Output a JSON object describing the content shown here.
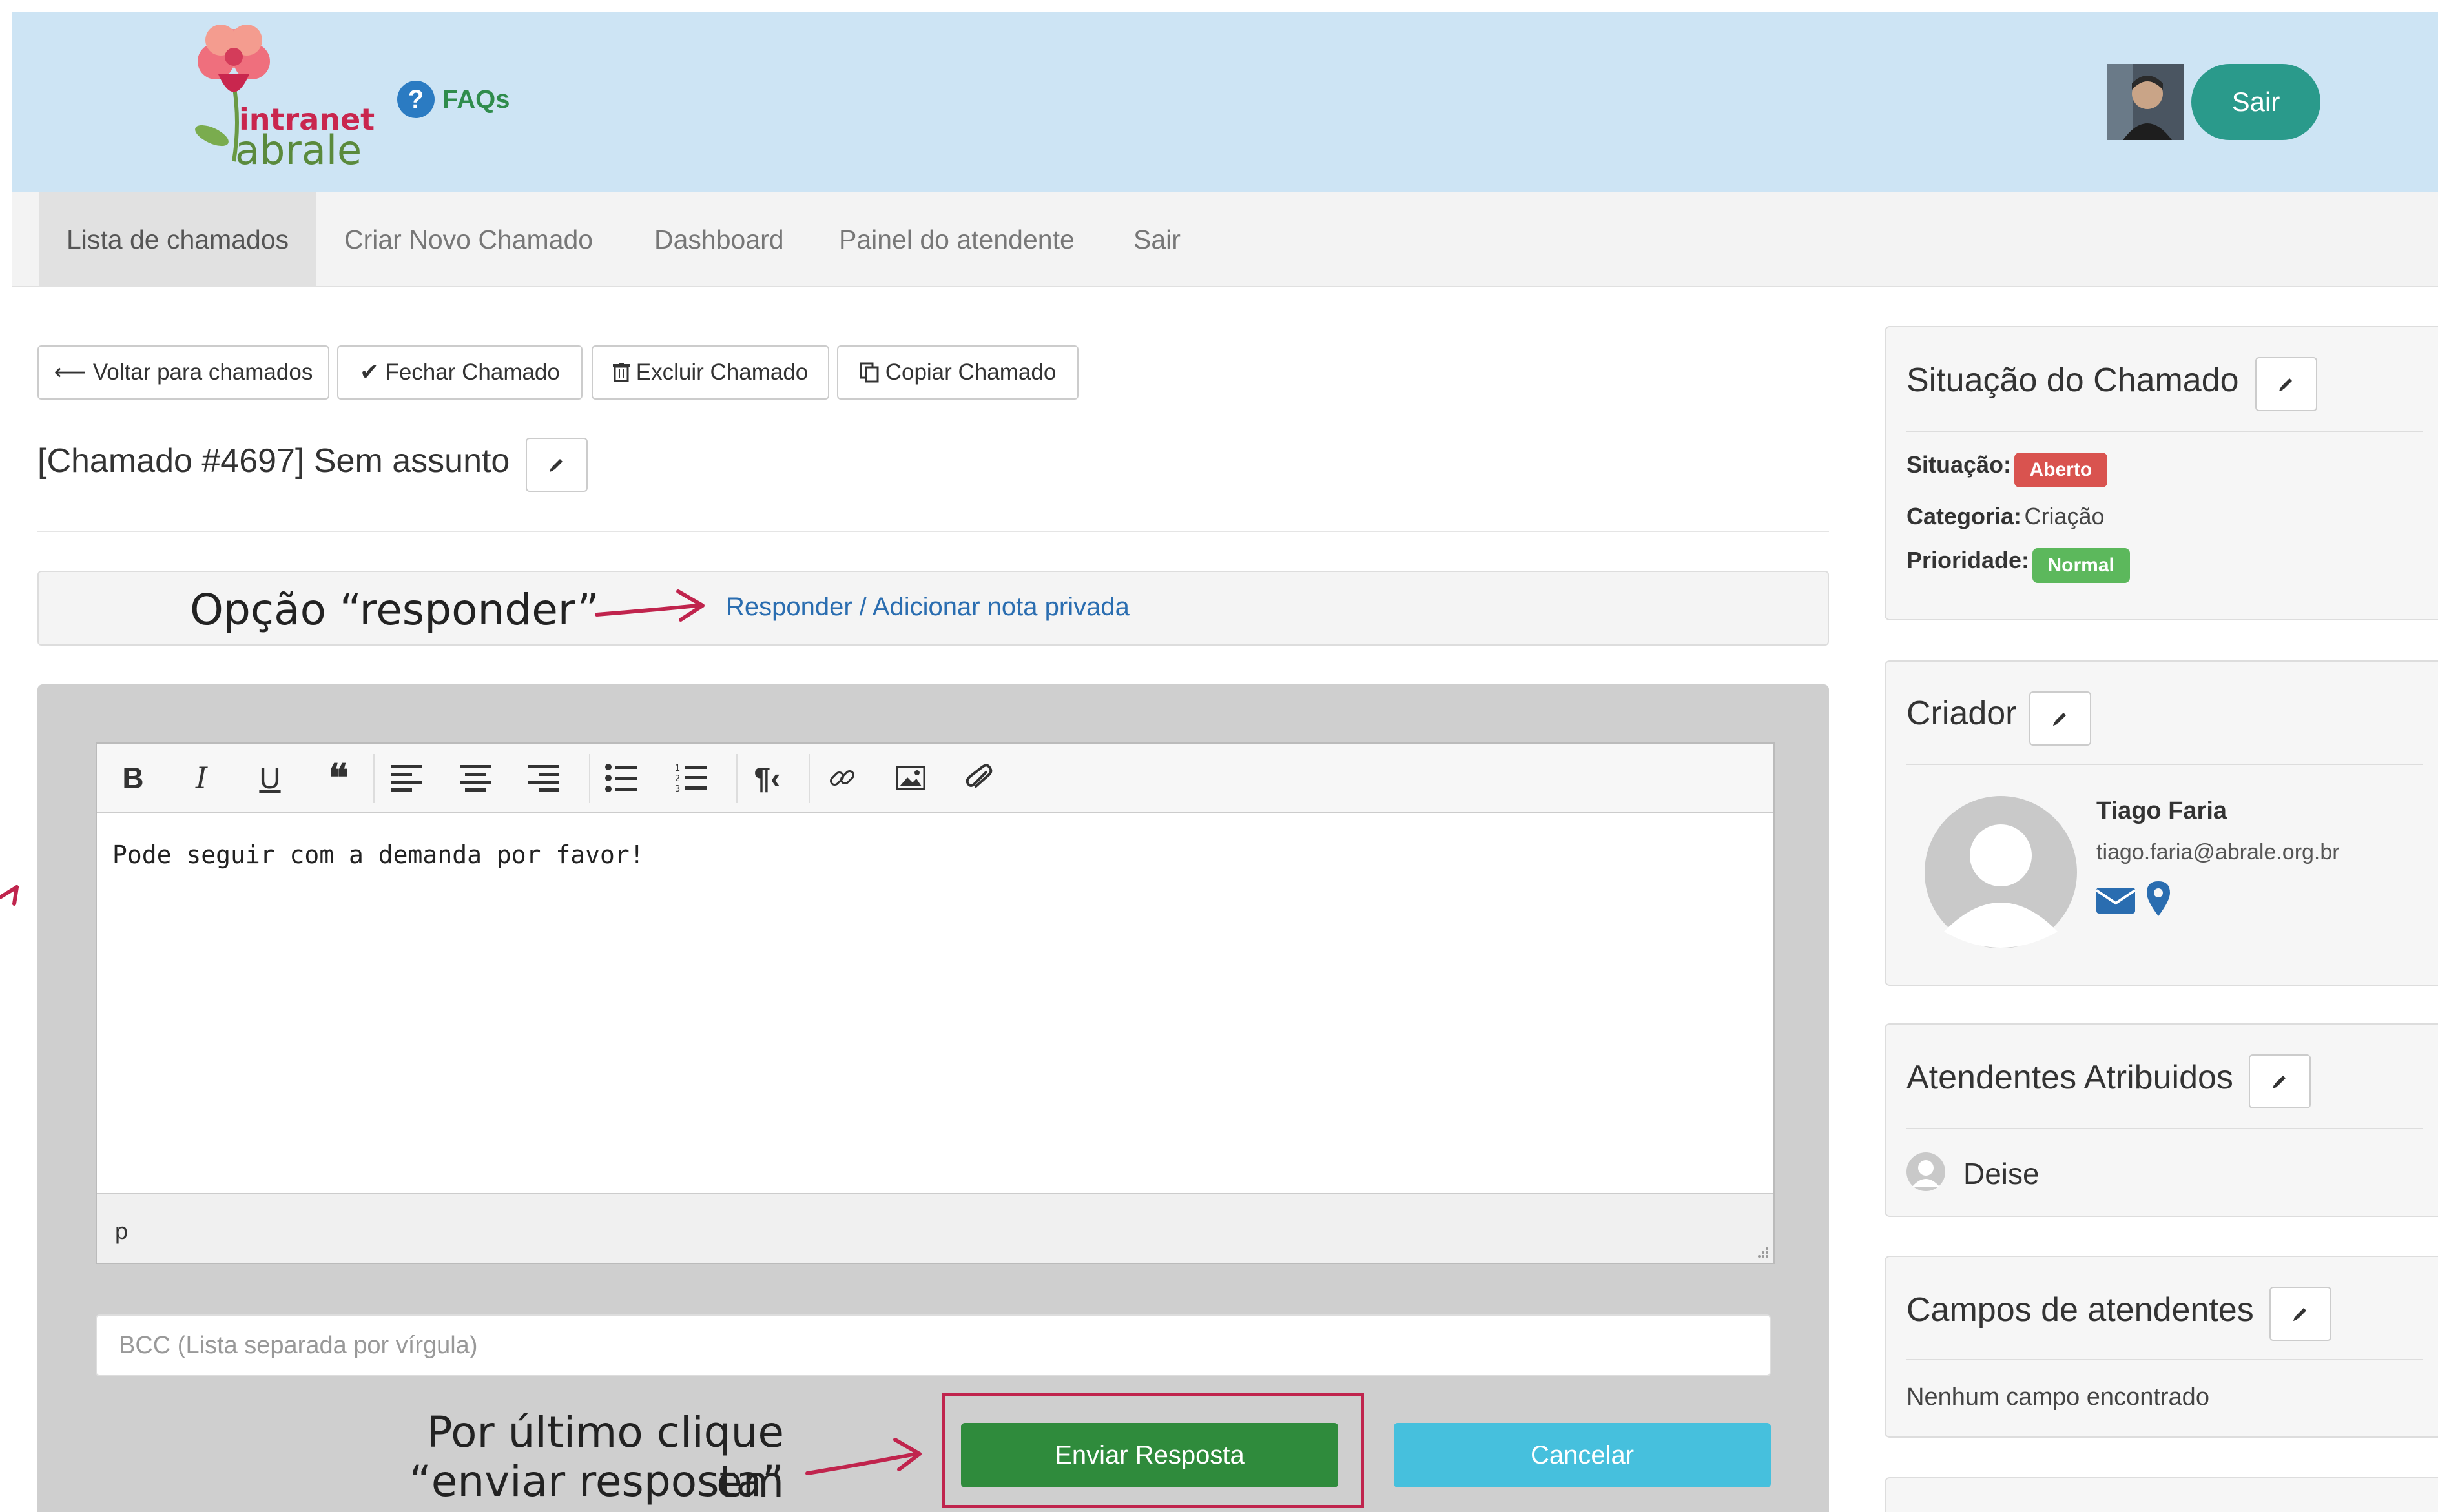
{
  "header": {
    "logo_line1": "intranet",
    "logo_line2": "abrale",
    "faq_icon": "?",
    "faq_label": "FAQs",
    "logout_label": "Sair"
  },
  "nav": {
    "items": [
      "Lista de chamados",
      "Criar Novo Chamado",
      "Dashboard",
      "Painel do atendente",
      "Sair"
    ],
    "active": "Lista de chamados"
  },
  "toolbar": {
    "back_label": "Voltar para chamados",
    "close_label": "Fechar Chamado",
    "delete_label": "Excluir Chamado",
    "copy_label": "Copiar Chamado"
  },
  "ticket": {
    "title": "[Chamado #4697] Sem assunto"
  },
  "reply": {
    "annotation": "Opção “responder”",
    "link_label": "Responder / Adicionar nota privada"
  },
  "editor": {
    "content": "Pode seguir com a demanda por favor!",
    "status_path": "p",
    "tools": [
      "bold-icon",
      "italic-icon",
      "underline-icon",
      "quote-icon",
      "align-left-icon",
      "align-center-icon",
      "align-right-icon",
      "bullet-list-icon",
      "numbered-list-icon",
      "paragraph-icon",
      "link-icon",
      "image-icon",
      "attachment-icon"
    ]
  },
  "bcc": {
    "placeholder": "BCC (Lista separada por vírgula)"
  },
  "actions": {
    "annotation_line1": "Por último clique em",
    "annotation_line2": "“enviar resposta”",
    "send_label": "Enviar Resposta",
    "cancel_label": "Cancelar"
  },
  "sidebar": {
    "status": {
      "title": "Situação do Chamado",
      "situacao_label": "Situação:",
      "situacao_value": "Aberto",
      "situacao_color": "#d9534f",
      "categoria_label": "Categoria:",
      "categoria_value": "Criação",
      "prioridade_label": "Prioridade:",
      "prioridade_value": "Normal",
      "prioridade_color": "#5cb85c"
    },
    "creator": {
      "title": "Criador",
      "name": "Tiago Faria",
      "email": "tiago.faria@abrale.org.br"
    },
    "assignees": {
      "title": "Atendentes Atribuidos",
      "names": [
        "Deise"
      ]
    },
    "agent_fields": {
      "title": "Campos de atendentes",
      "empty": "Nenhum campo encontrado"
    }
  },
  "colors": {
    "header_bg": "#cde4f4",
    "primary_green": "#2f8b3c",
    "cancel_blue": "#46c0dd",
    "annotation_red": "#c0244d",
    "link_blue": "#2a6db0"
  }
}
